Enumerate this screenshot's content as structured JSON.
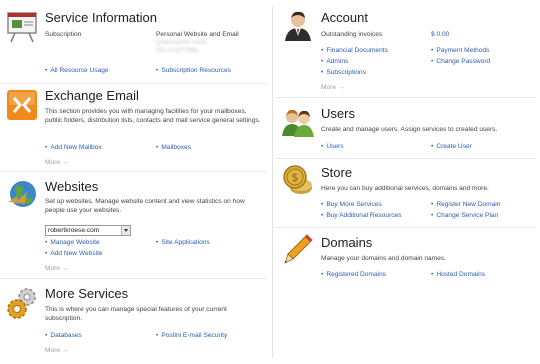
{
  "service_info": {
    "title": "Service Information",
    "subscription_label": "Subscription",
    "subscription_value": "Personal Website and Email",
    "blurred_1": "(yllanrworth.com)",
    "blurred_2": "(ID:#1327786)",
    "links": [
      "All Resource Usage",
      "Subscription Resources"
    ]
  },
  "exchange_email": {
    "title": "Exchange Email",
    "description": "This section provides you with managing facilities for your mailboxes, public folders, distribution lists, contacts and mail service general settings.",
    "links": [
      "Add New Mailbox",
      "Mailboxes"
    ],
    "more": "More →"
  },
  "websites": {
    "title": "Websites",
    "description": "Set up websites. Manage website content and view statistics on how people use your websites.",
    "selected_site": "robertkroese.com",
    "links": [
      "Manage Website",
      "Site Applications",
      "Add New Website"
    ],
    "more": "More →"
  },
  "more_services": {
    "title": "More Services",
    "description": "This is where you can manage special features of your current subscription.",
    "links": [
      "Databases",
      "Postini E-mail Security"
    ],
    "more": "More →"
  },
  "account": {
    "title": "Account",
    "outstanding_label": "Outstanding invoices",
    "outstanding_value": "$ 0.00",
    "links": [
      "Financial Documents",
      "Payment Methods",
      "Admins",
      "Change Password",
      "Subscriptions"
    ],
    "more": "More →"
  },
  "users": {
    "title": "Users",
    "description": "Create and manage users. Assign services to created users.",
    "links": [
      "Users",
      "Create User"
    ]
  },
  "store": {
    "title": "Store",
    "description": "Here you can buy additional services, domains and more.",
    "links": [
      "Buy More Services",
      "Register New Domain",
      "Buy Additional Resources",
      "Change Service Plan"
    ]
  },
  "domains": {
    "title": "Domains",
    "description": "Manage your domains and domain names.",
    "links": [
      "Registered Domains",
      "Hosted Domains"
    ]
  },
  "icons": {
    "service_info": "presentation-board-icon",
    "exchange_email": "exchange-logo-icon",
    "websites": "globe-icon",
    "more_services": "gears-icon",
    "account": "businessman-icon",
    "users": "users-icon",
    "store": "coins-icon",
    "domains": "pencil-icon"
  },
  "colors": {
    "link": "#2a5db0",
    "title": "#222222",
    "muted": "#a0a0a0",
    "separator": "#e6e6e6"
  }
}
